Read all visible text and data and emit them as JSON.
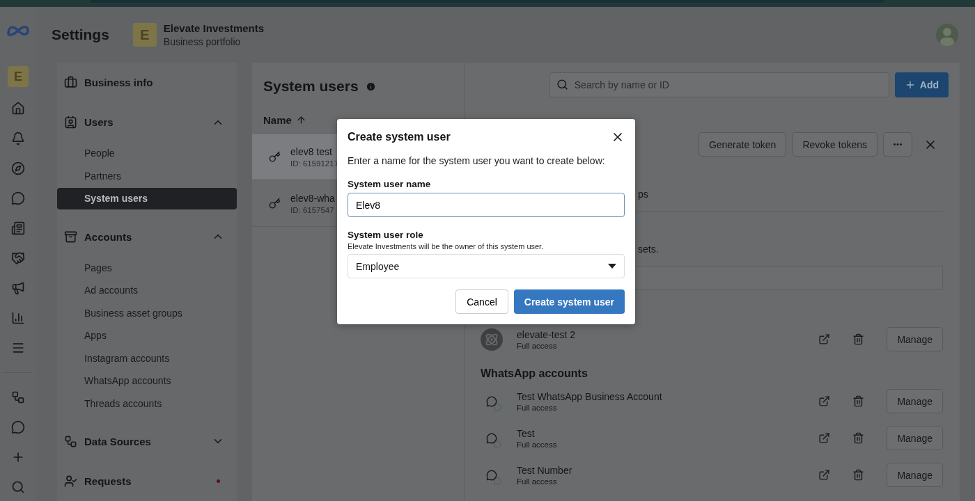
{
  "header": {
    "title": "Settings",
    "portfolio": {
      "initial": "E",
      "name": "Elevate Investments",
      "subtitle": "Business portfolio"
    }
  },
  "rail": {
    "initial": "E"
  },
  "sidebar": {
    "sections": [
      {
        "label": "Business info"
      },
      {
        "label": "Users",
        "expanded": true,
        "children": [
          {
            "label": "People",
            "selected": false
          },
          {
            "label": "Partners",
            "selected": false
          },
          {
            "label": "System users",
            "selected": true
          }
        ]
      },
      {
        "label": "Accounts",
        "expanded": true,
        "children": [
          {
            "label": "Pages",
            "selected": false
          },
          {
            "label": "Ad accounts",
            "selected": false
          },
          {
            "label": "Business asset groups",
            "selected": false
          },
          {
            "label": "Apps",
            "selected": false
          },
          {
            "label": "Instagram accounts",
            "selected": false
          },
          {
            "label": "WhatsApp accounts",
            "selected": false
          },
          {
            "label": "Threads accounts",
            "selected": false
          }
        ]
      },
      {
        "label": "Data Sources",
        "expanded": false
      },
      {
        "label": "Requests",
        "notification": true
      }
    ]
  },
  "list": {
    "title": "System users",
    "column": "Name",
    "search_placeholder": "Search by name or ID",
    "add_label": "Add",
    "rows": [
      {
        "name": "elev8 test",
        "id": "ID: 61591217",
        "selected": true
      },
      {
        "name": "elev8-wha",
        "id": "ID: 6157547",
        "selected": false
      }
    ]
  },
  "detail": {
    "buttons": [
      "Generate token",
      "Revoke tokens"
    ],
    "fragments": [
      "ps",
      "sets."
    ],
    "assets": [
      {
        "name": "elevate-test 2",
        "access": "Full access",
        "manage": "Manage"
      }
    ],
    "whatsapp_heading": "WhatsApp accounts",
    "whatsapp_accounts": [
      {
        "name": "Test WhatsApp Business Account",
        "access": "Full access",
        "manage": "Manage"
      },
      {
        "name": "Test",
        "access": "Full access",
        "manage": "Manage"
      },
      {
        "name": "Test Number",
        "access": "Full access",
        "manage": "Manage"
      }
    ]
  },
  "modal": {
    "title": "Create system user",
    "description": "Enter a name for the system user you want to create below:",
    "name_label": "System user name",
    "name_value": "Elev8",
    "role_label": "System user role",
    "role_hint": "Elevate Investments will be the owner of this system user.",
    "role_value": "Employee",
    "cancel": "Cancel",
    "submit": "Create system user"
  }
}
